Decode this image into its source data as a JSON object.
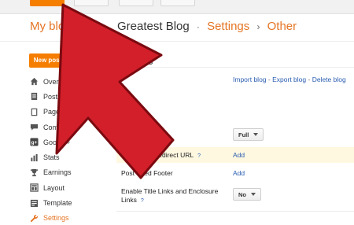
{
  "header": {
    "my_blogs": "My blo",
    "blog_name": "Greatest Blog",
    "sep1": "·",
    "settings": "Settings",
    "sep2": "›",
    "other": "Other"
  },
  "sidebar": {
    "new_post": "New post",
    "items": [
      {
        "label": "Overview",
        "icon": "home-icon"
      },
      {
        "label": "Posts",
        "icon": "posts-icon"
      },
      {
        "label": "Pages",
        "icon": "pages-icon"
      },
      {
        "label": "Comments",
        "icon": "comments-icon"
      },
      {
        "label": "Google+",
        "icon": "google-plus-icon"
      },
      {
        "label": "Stats",
        "icon": "stats-icon"
      },
      {
        "label": "Earnings",
        "icon": "earnings-icon"
      },
      {
        "label": "Layout",
        "icon": "layout-icon"
      },
      {
        "label": "Template",
        "icon": "template-icon"
      },
      {
        "label": "Settings",
        "icon": "wrench-icon",
        "active": true
      }
    ]
  },
  "main": {
    "title": "ls",
    "import_blog": "Import blog",
    "export_blog": "Export blog",
    "delete_blog": "Delete blog",
    "dash": "-",
    "full_option": "Full",
    "redirect_label": "Post Feed Redirect URL",
    "redirect_add": "Add",
    "footer_label": "Post Feed Footer",
    "footer_add": "Add",
    "enclosure_label_1": "Enable Title Links and Enclosure",
    "enclosure_label_2": "Links",
    "enclosure_option": "No",
    "help": "?"
  },
  "colors": {
    "accent": "#f57d00",
    "link": "#2a5db0",
    "arrow": "#d21f2a"
  }
}
